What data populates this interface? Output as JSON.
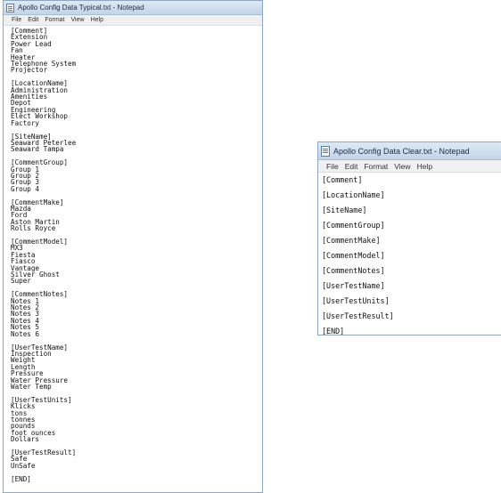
{
  "windows": [
    {
      "title": "Apollo Config Data Typical.txt - Notepad",
      "menu": [
        "File",
        "Edit",
        "Format",
        "View",
        "Help"
      ],
      "lines": [
        "[Comment]",
        "Extension",
        "Power Lead",
        "Fan",
        "Heater",
        "Telephone System",
        "Projector",
        "",
        "[LocationName]",
        "Administration",
        "Amenities",
        "Depot",
        "Engineering",
        "Elect Workshop",
        "Factory",
        "",
        "[SiteName]",
        "Seaward Peterlee",
        "Seaward Tampa",
        "",
        "[CommentGroup]",
        "Group 1",
        "Group 2",
        "Group 3",
        "Group 4",
        "",
        "[CommentMake]",
        "Mazda",
        "Ford",
        "Aston Martin",
        "Rolls Royce",
        "",
        "[CommentModel]",
        "MX3",
        "Fiesta",
        "Fiasco",
        "Vantage",
        "Silver Ghost",
        "Super",
        "",
        "[CommentNotes]",
        "Notes 1",
        "Notes 2",
        "Notes 3",
        "Notes 4",
        "Notes 5",
        "Notes 6",
        "",
        "[UserTestName]",
        "Inspection",
        "Weight",
        "Length",
        "Pressure",
        "Water Pressure",
        "Water Temp",
        "",
        "[UserTestUnits]",
        "Klicks",
        "tons",
        "tonnes",
        "pounds",
        "foot ounces",
        "Dollars",
        "",
        "[UserTestResult]",
        "Safe",
        "UnSafe",
        "",
        "[END]"
      ]
    },
    {
      "title": "Apollo Config Data Clear.txt - Notepad",
      "menu": [
        "File",
        "Edit",
        "Format",
        "View",
        "Help"
      ],
      "lines": [
        "[Comment]",
        "[LocationName]",
        "[SiteName]",
        "[CommentGroup]",
        "[CommentMake]",
        "[CommentModel]",
        "[CommentNotes]",
        "[UserTestName]",
        "[UserTestUnits]",
        "[UserTestResult]",
        "[END]"
      ]
    }
  ]
}
